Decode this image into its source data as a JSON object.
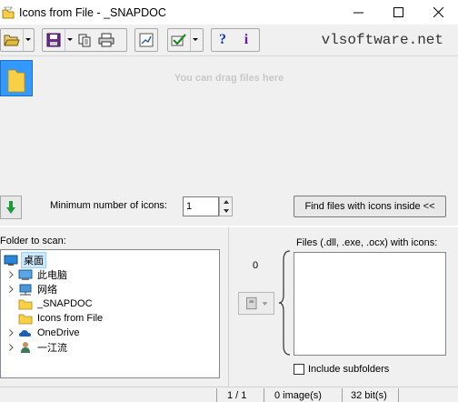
{
  "window": {
    "title": "Icons from File - _SNAPDOC",
    "minimize": "—",
    "maximize": "☐",
    "close": "✕"
  },
  "toolbar": {
    "brand": "vlsoftware.net",
    "buttons": [
      {
        "name": "open-folder-icon"
      },
      {
        "name": "save-icon"
      },
      {
        "name": "copy-icon"
      },
      {
        "name": "print-icon"
      },
      {
        "name": "chart-icon"
      },
      {
        "name": "check-icon"
      },
      {
        "name": "help-icon",
        "label": "?"
      },
      {
        "name": "info-icon",
        "label": "i"
      }
    ]
  },
  "drop_area": {
    "hint": "You can drag files here"
  },
  "controls": {
    "min_label": "Minimum number of icons:",
    "min_value": "1",
    "find_button": "Find files with icons inside <<"
  },
  "scan": {
    "label": "Folder to scan:",
    "tree": [
      {
        "label": "桌面",
        "selected": true,
        "expandable": false,
        "indent": 0,
        "icon": "desktop-icon"
      },
      {
        "label": "此电脑",
        "selected": false,
        "expandable": true,
        "indent": 1,
        "icon": "computer-icon"
      },
      {
        "label": "网络",
        "selected": false,
        "expandable": true,
        "indent": 1,
        "icon": "network-icon"
      },
      {
        "label": "_SNAPDOC",
        "selected": false,
        "expandable": false,
        "indent": 1,
        "icon": "folder-icon"
      },
      {
        "label": "Icons from File",
        "selected": false,
        "expandable": false,
        "indent": 1,
        "icon": "folder-icon"
      },
      {
        "label": "OneDrive",
        "selected": false,
        "expandable": true,
        "indent": 1,
        "icon": "cloud-icon"
      },
      {
        "label": "一江流",
        "selected": false,
        "expandable": true,
        "indent": 1,
        "icon": "user-icon"
      }
    ]
  },
  "files": {
    "label": "Files (.dll, .exe, .ocx) with icons:",
    "count": "0",
    "include_subfolders": "Include subfolders"
  },
  "status": {
    "page": "1 / 1",
    "images": "0 image(s)",
    "bits": "32 bit(s)"
  }
}
